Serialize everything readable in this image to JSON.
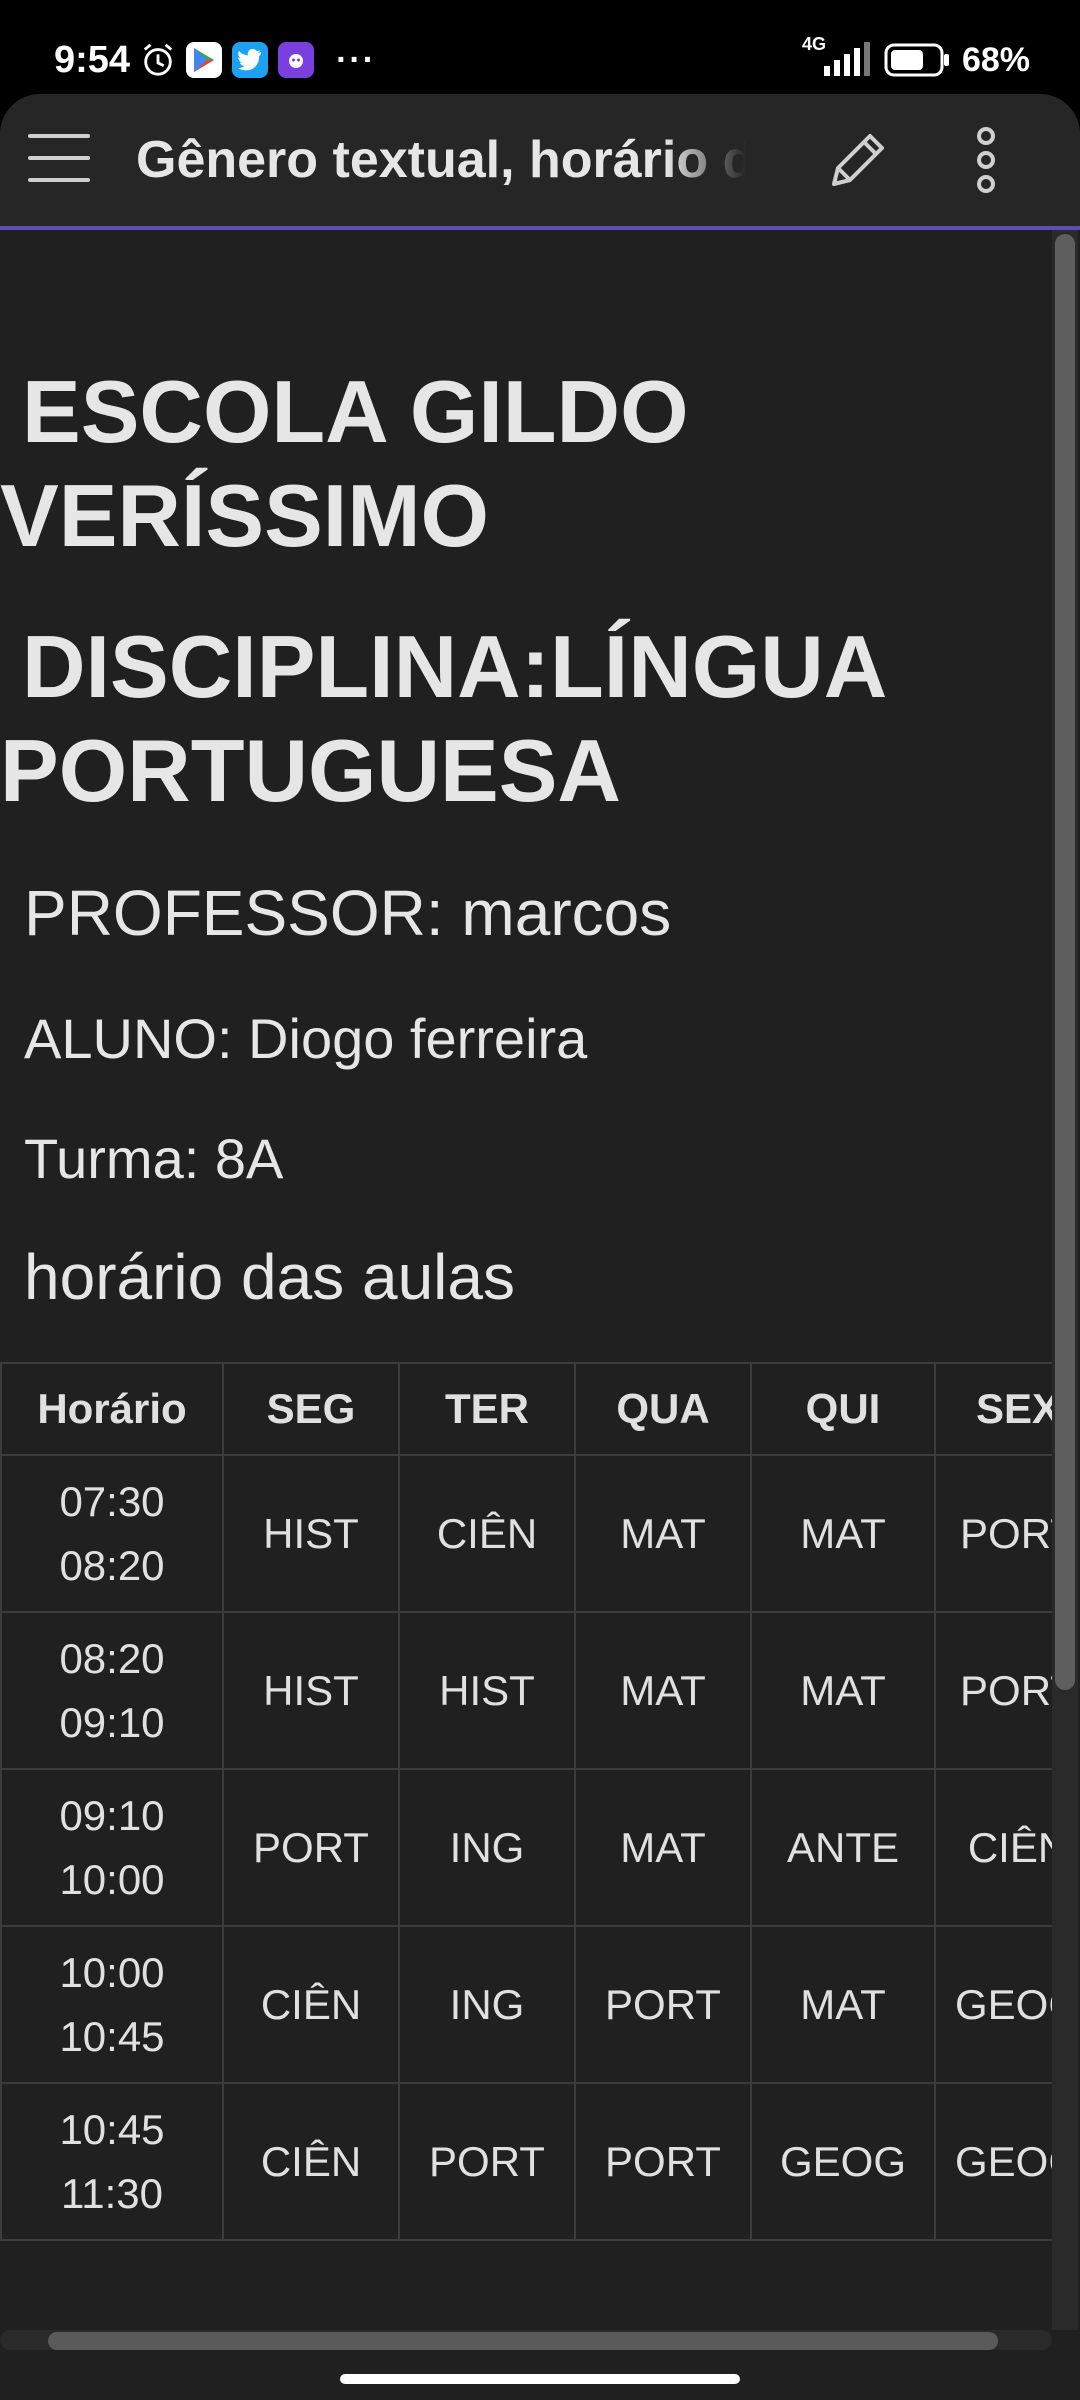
{
  "status_bar": {
    "time": "9:54",
    "icons_left": [
      "alarm-icon",
      "play-store-icon",
      "twitter-icon",
      "app-icon"
    ],
    "more": "···",
    "network": "4G",
    "battery": "68%"
  },
  "app_bar": {
    "title": "Gênero textual, horário das aulas",
    "menu_icon": "menu-icon",
    "edit_icon": "pencil-icon",
    "more_icon": "more-vert-icon"
  },
  "document": {
    "heading1": "ESCOLA GILDO VERÍSSIMO",
    "heading2": "DISCIPLINA:LÍNGUA PORTUGUESA",
    "professor": "PROFESSOR: marcos",
    "aluno": "ALUNO: Diogo ferreira",
    "turma": "Turma: 8A",
    "schedule_title": "horário das aulas"
  },
  "schedule": {
    "headers": [
      "Horário",
      "SEG",
      "TER",
      "QUA",
      "QUI",
      "SEX"
    ],
    "rows": [
      {
        "start": "07:30",
        "end": "08:20",
        "cells": [
          "HIST",
          "CIÊN",
          "MAT",
          "MAT",
          "PORT"
        ]
      },
      {
        "start": "08:20",
        "end": "09:10",
        "cells": [
          "HIST",
          "HIST",
          "MAT",
          "MAT",
          "PORT"
        ]
      },
      {
        "start": "09:10",
        "end": "10:00",
        "cells": [
          "PORT",
          "ING",
          "MAT",
          "ANTE",
          "CIÊN"
        ]
      },
      {
        "start": "10:00",
        "end": "10:45",
        "cells": [
          "CIÊN",
          "ING",
          "PORT",
          "MAT",
          "GEOG"
        ]
      },
      {
        "start": "10:45",
        "end": "11:30",
        "cells": [
          "CIÊN",
          "PORT",
          "PORT",
          "GEOG",
          "GEOG"
        ]
      }
    ]
  },
  "colors": {
    "background": "#202020",
    "app_bar": "#262626",
    "accent": "#5b4fb3",
    "text": "#e6e6e6"
  }
}
